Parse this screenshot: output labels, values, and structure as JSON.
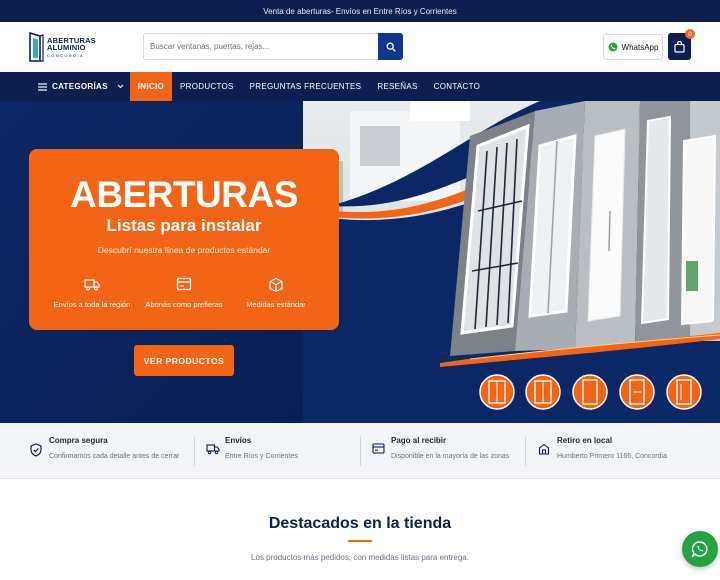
{
  "topbar": {
    "text": "Venta de aberturas- Envíos en Entre Ríos y Corrientes"
  },
  "logo": {
    "line1": "ABERTURAS",
    "line2": "ALUMINIO",
    "line3": "CONCORDIA"
  },
  "search": {
    "placeholder": "Buscar ventanas, puertas, rejas..."
  },
  "header": {
    "whatsapp_label": "WhatsApp",
    "cart_count": "0"
  },
  "nav": {
    "categories_label": "CATEGORÍAS",
    "items": [
      "INICIO",
      "PRODUCTOS",
      "PREGUNTAS FRECUENTES",
      "RESEÑAS",
      "CONTACTO"
    ]
  },
  "hero": {
    "title": "ABERTURAS",
    "subtitle": "Listas para instalar",
    "description": "Descubrí nuestra línea de productos estándar",
    "features": [
      {
        "icon": "truck-icon",
        "label": "Envíos a toda la región"
      },
      {
        "icon": "card-icon",
        "label": "Abonás como prefieras"
      },
      {
        "icon": "box-icon",
        "label": "Medidas estándar"
      }
    ],
    "cta": "VER PRODUCTOS"
  },
  "info": [
    {
      "icon": "shield-check-icon",
      "title": "Compra segura",
      "desc": "Confirmamos cada detalle antes de cerrar"
    },
    {
      "icon": "truck-icon",
      "title": "Envíos",
      "desc": "Entre Ríos y Corrientes"
    },
    {
      "icon": "wallet-icon",
      "title": "Pago al recibir",
      "desc": "Disponible en la mayoría de las zonas"
    },
    {
      "icon": "store-icon",
      "title": "Retiro en local",
      "desc": "Humberto Primero 1166, Concordia"
    }
  ],
  "featured": {
    "title": "Destacados en la tienda",
    "subtitle": "Los productos más pedidos, con medidas listas para entrega."
  },
  "colors": {
    "navy": "#0c1f4e",
    "orange": "#f26516",
    "whatsapp_green": "#25a244"
  }
}
